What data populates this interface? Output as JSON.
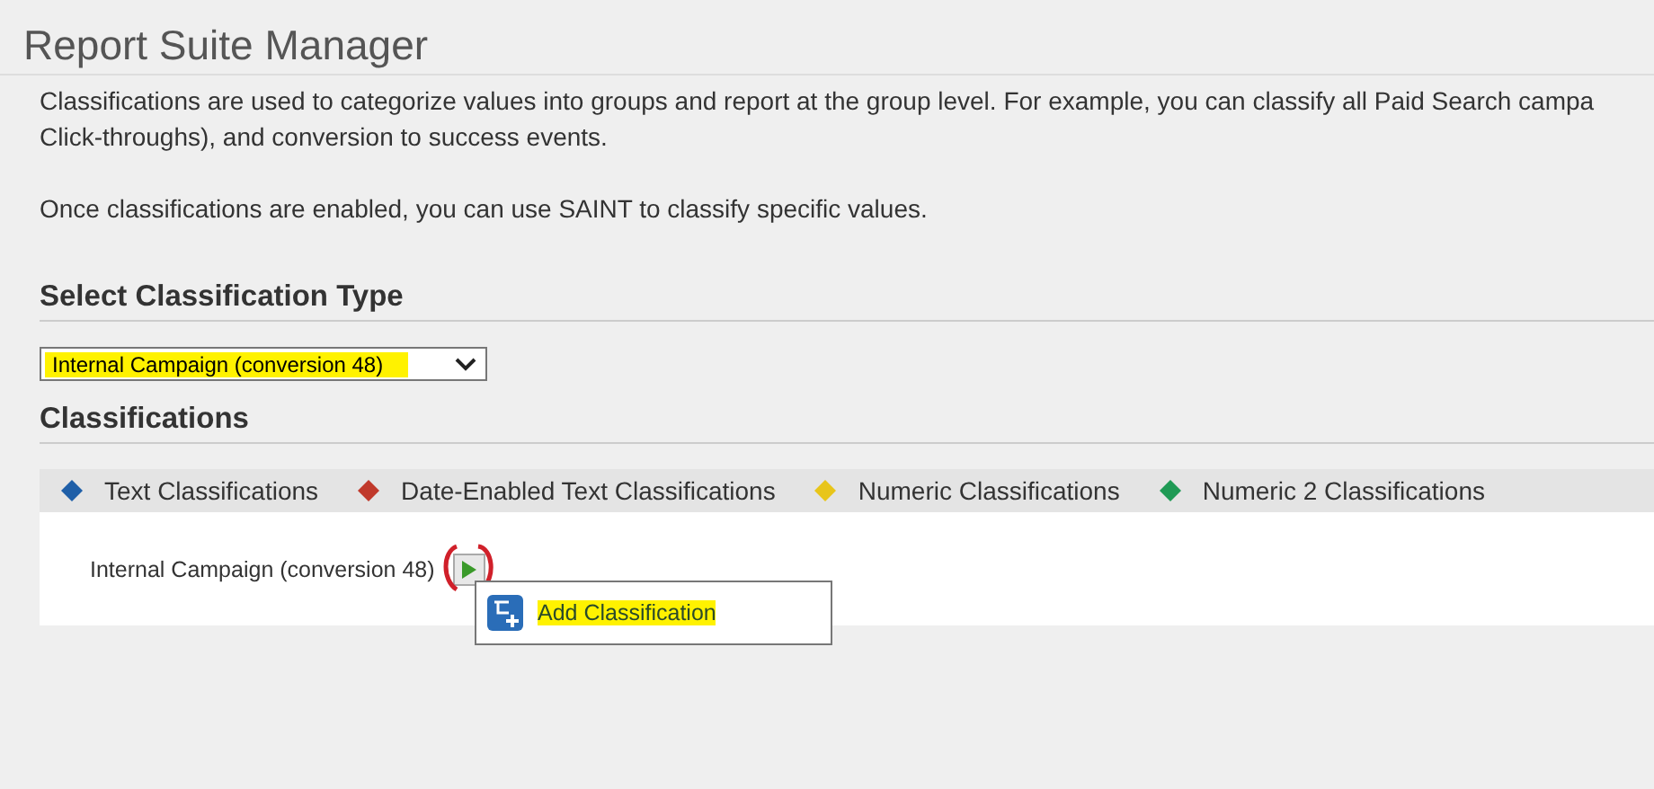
{
  "page_title": "Report Suite Manager",
  "intro": [
    "Classifications are used to categorize values into groups and report at the group level. For example, you can classify all Paid Search campa",
    "Click-throughs), and conversion to success events."
  ],
  "note": "Once classifications are enabled, you can use SAINT to classify specific values.",
  "type_section": {
    "heading": "Select Classification Type",
    "select": {
      "value": "Internal Campaign (conversion 48)",
      "highlighted": true
    }
  },
  "classifications_section": {
    "heading": "Classifications",
    "legend": [
      {
        "label": "Text Classifications",
        "color": "#1f5fa8"
      },
      {
        "label": "Date-Enabled Text Classifications",
        "color": "#c0392b"
      },
      {
        "label": "Numeric Classifications",
        "color": "#e8c51a"
      },
      {
        "label": "Numeric 2 Classifications",
        "color": "#1f9a55"
      }
    ],
    "row": {
      "label": "Internal Campaign (conversion 48)",
      "circled": true
    },
    "menu": [
      {
        "label": "Add Classification",
        "highlighted": true
      }
    ]
  }
}
